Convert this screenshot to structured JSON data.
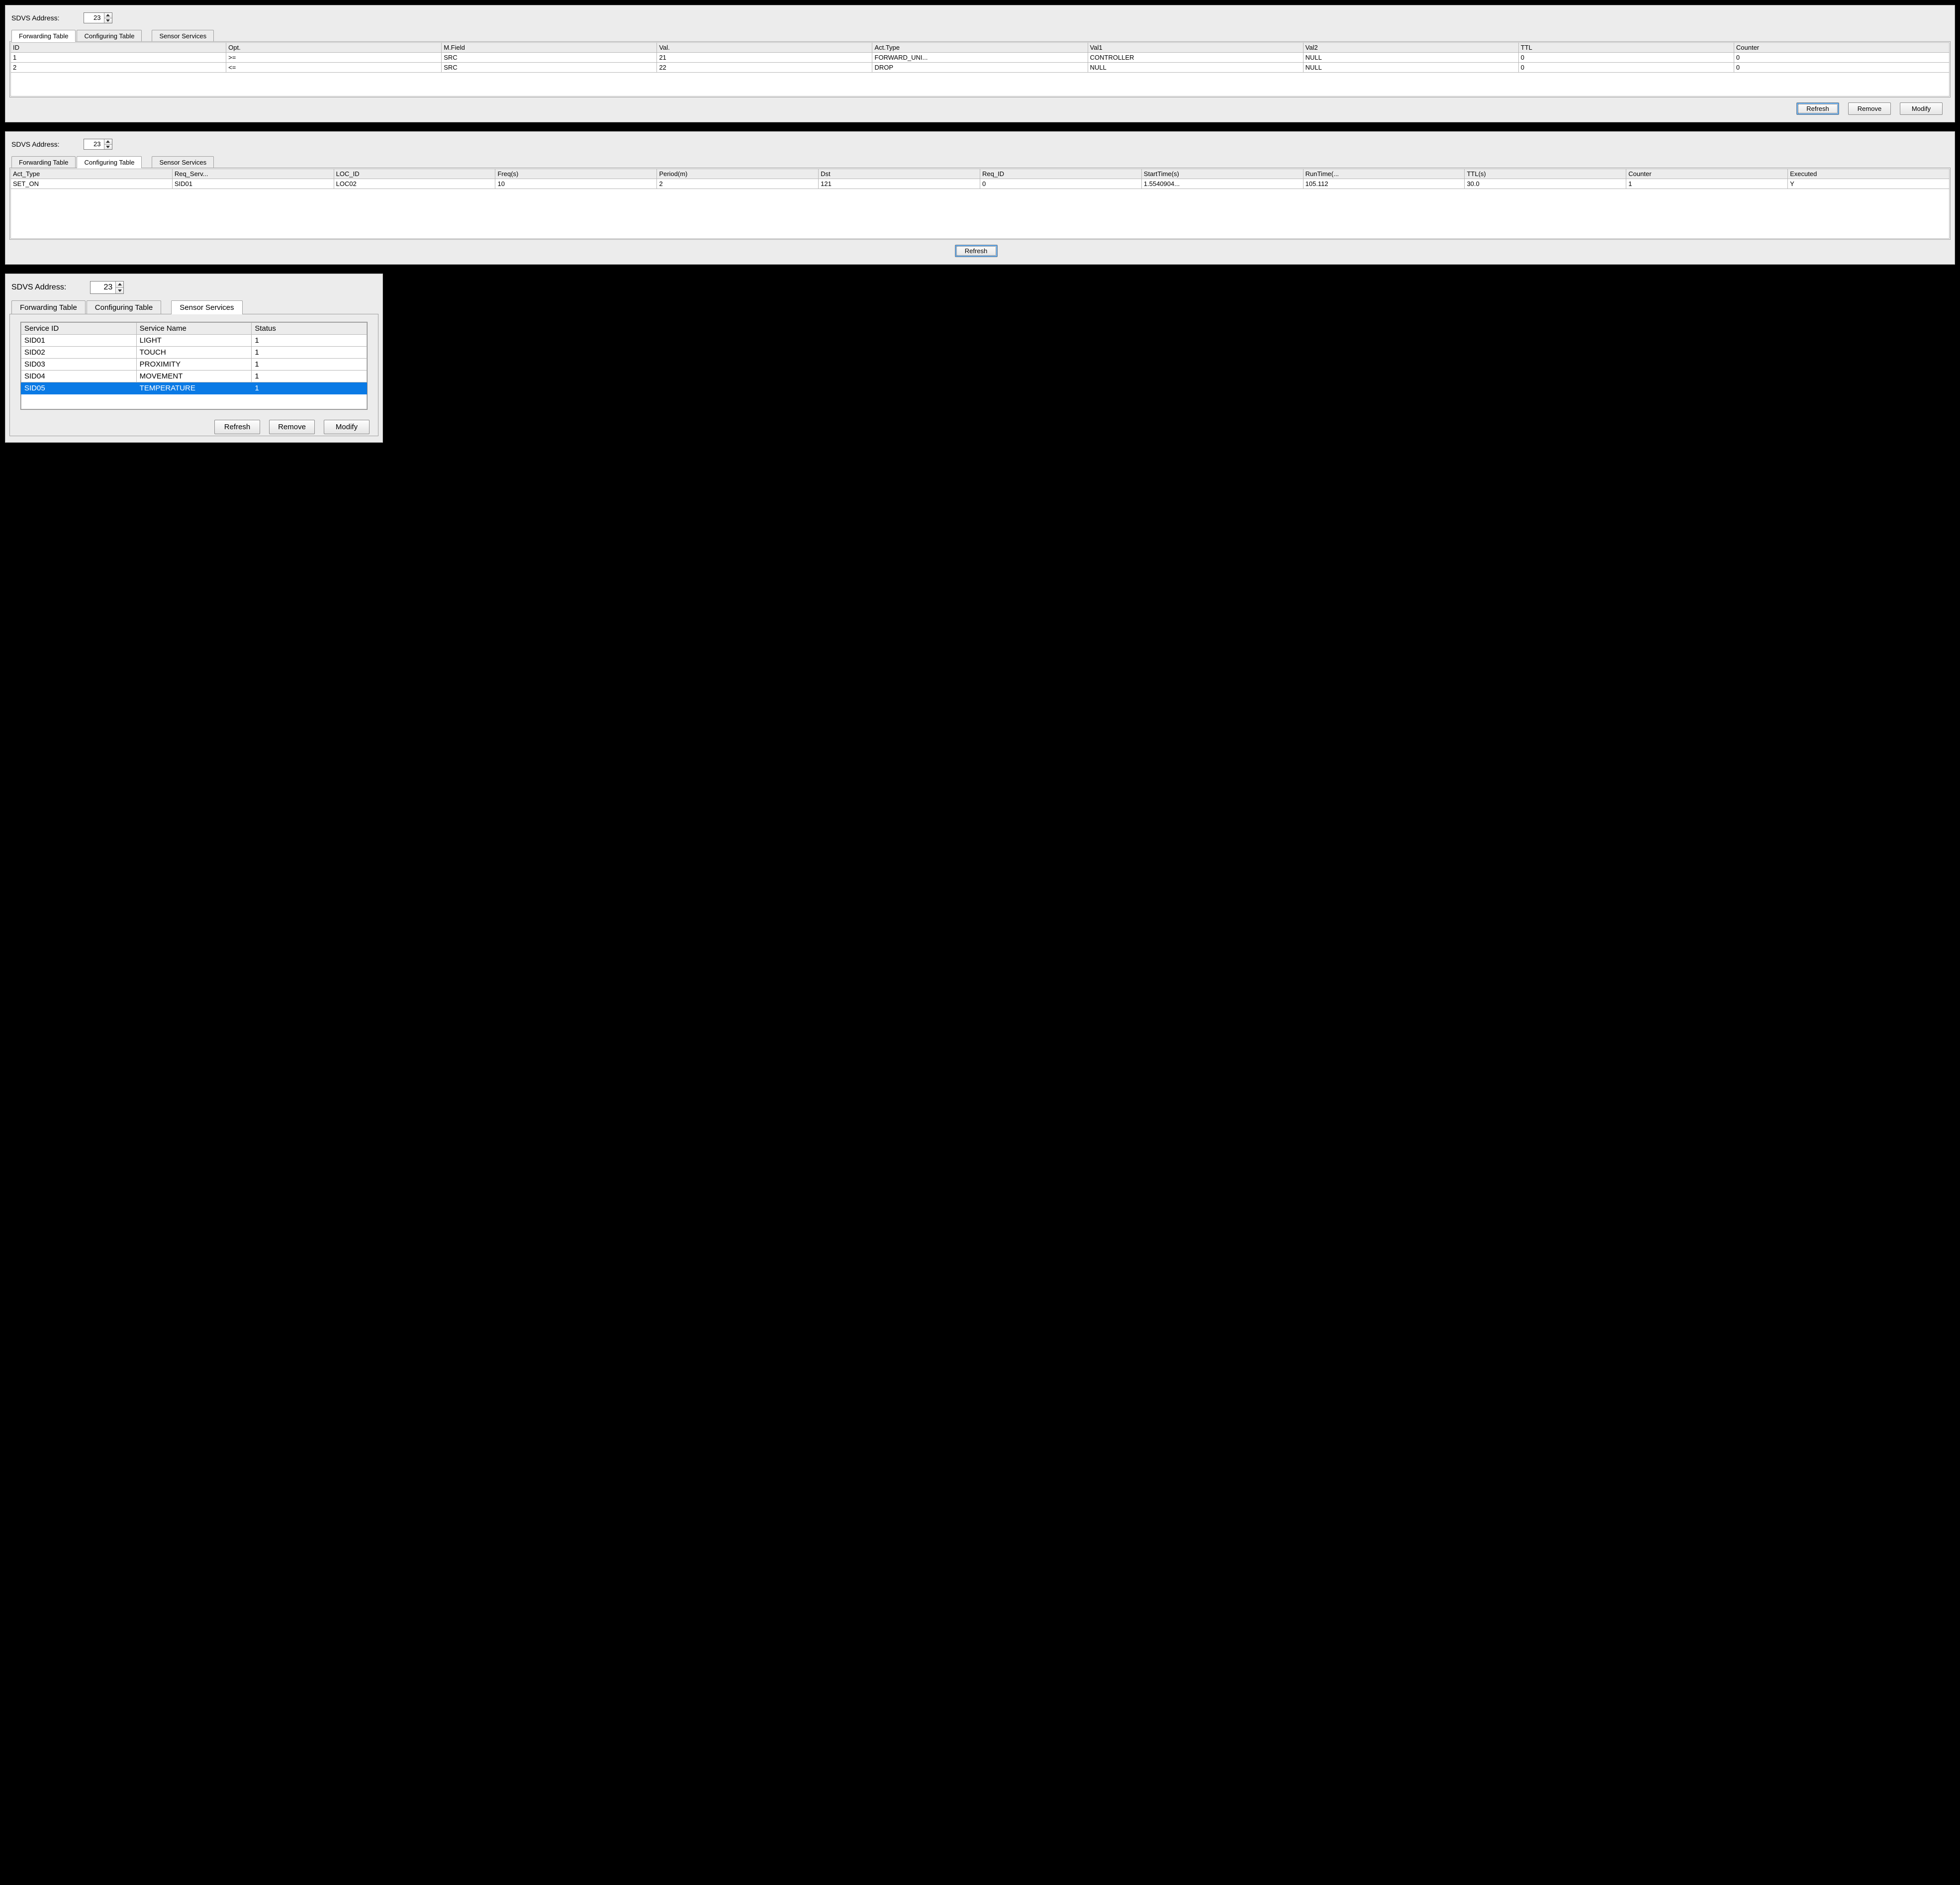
{
  "labels": {
    "sdvs_address": "SDVS Address:",
    "tabs": {
      "forwarding": "Forwarding Table",
      "configuring": "Configuring Table",
      "sensor": "Sensor Services"
    },
    "buttons": {
      "refresh": "Refresh",
      "remove": "Remove",
      "modify": "Modify"
    }
  },
  "panelA": {
    "address": "23",
    "active_tab": "forwarding",
    "columns": [
      "ID",
      "Opt.",
      "M.Field",
      "Val.",
      "Act.Type",
      "Val1",
      "Val2",
      "TTL",
      "Counter"
    ],
    "rows": [
      [
        "1",
        ">=",
        "SRC",
        "21",
        "FORWARD_UNI...",
        "CONTROLLER",
        "NULL",
        "0",
        "0"
      ],
      [
        "2",
        "<=",
        "SRC",
        "22",
        "DROP",
        "NULL",
        "NULL",
        "0",
        "0"
      ]
    ]
  },
  "panelB": {
    "address": "23",
    "active_tab": "configuring",
    "columns": [
      "Act_Type",
      "Req_Serv...",
      "LOC_ID",
      "Freq(s)",
      "Period(m)",
      "Dst",
      "Req_ID",
      "StartTime(s)",
      "RunTime(...",
      "TTL(s)",
      "Counter",
      "Executed"
    ],
    "rows": [
      [
        "SET_ON",
        "SID01",
        "LOC02",
        "10",
        "2",
        "121",
        "0",
        "1.5540904...",
        "105.112",
        "30.0",
        "1",
        "Y"
      ]
    ]
  },
  "panelC": {
    "address": "23",
    "active_tab": "sensor",
    "columns": [
      "Service ID",
      "Service Name",
      "Status"
    ],
    "rows": [
      [
        "SID01",
        "LIGHT",
        "1"
      ],
      [
        "SID02",
        "TOUCH",
        "1"
      ],
      [
        "SID03",
        "PROXIMITY",
        "1"
      ],
      [
        "SID04",
        "MOVEMENT",
        "1"
      ],
      [
        "SID05",
        "TEMPERATURE",
        "1"
      ]
    ],
    "selected_row_index": 4
  }
}
